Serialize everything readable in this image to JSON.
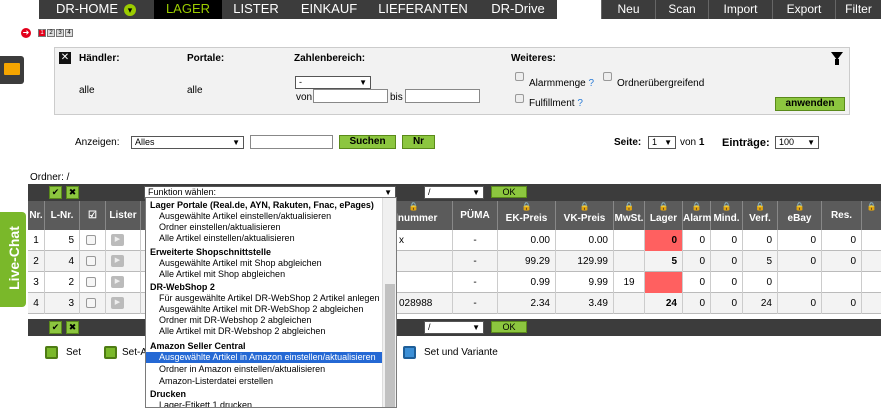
{
  "nav": {
    "items": [
      "DR-HOME",
      "LAGER",
      "LISTER",
      "EINKAUF",
      "LIEFERANTEN",
      "DR-Drive"
    ],
    "active": "LAGER",
    "right": [
      "Neu",
      "Scan",
      "Import",
      "Export",
      "Filter"
    ]
  },
  "pager": [
    "1",
    "2",
    "3",
    "4"
  ],
  "filter": {
    "haendler_label": "Händler:",
    "haendler_value": "alle",
    "portale_label": "Portale:",
    "portale_value": "alle",
    "zahlenbereich_label": "Zahlenbereich:",
    "zahlenbereich_select": "-",
    "von_label": "von",
    "bis_label": "bis",
    "weiteres_label": "Weiteres:",
    "alarmmenge_label": "Alarmmenge",
    "ordner_label": "Ordnerübergreifend",
    "fulfillment_label": "Fulfillment",
    "help": "?",
    "apply_label": "anwenden"
  },
  "search": {
    "anzeigen_label": "Anzeigen:",
    "anzeigen_value": "Alles",
    "search_label": "Suchen",
    "nr_label": "Nr",
    "seite_label": "Seite:",
    "seite_value": "1",
    "von_text": "von",
    "total_pages": "1",
    "eintraege_label": "Einträge:",
    "eintraege_value": "100"
  },
  "table": {
    "ordner_label": "Ordner: /",
    "funktion_select": "Funktion wählen:",
    "folder_select": "/",
    "ok_label": "OK",
    "lock_glyph": "🔒",
    "columns": [
      "Nr.",
      "L-Nr.",
      "☑",
      "Lister",
      "",
      "",
      "elnummer",
      "PÜMA",
      "EK-Preis",
      "VK-Preis",
      "MwSt.",
      "Lager",
      "Alarm",
      "Mind.",
      "Verf.",
      "eBay",
      "Res.",
      ""
    ],
    "rows": [
      {
        "nr": "1",
        "lnr": "5",
        "artnr": "x",
        "puema": "-",
        "ek": "0.00",
        "vk": "0.00",
        "mwst": "",
        "lager": "0",
        "alarm": "0",
        "mind": "0",
        "verf": "0",
        "ebay": "0",
        "res": "0"
      },
      {
        "nr": "2",
        "lnr": "4",
        "artnr": "",
        "puema": "-",
        "ek": "99.29",
        "vk": "129.99",
        "mwst": "",
        "lager": "5",
        "alarm": "0",
        "mind": "0",
        "verf": "5",
        "ebay": "0",
        "res": "0"
      },
      {
        "nr": "3",
        "lnr": "2",
        "artnr": "",
        "puema": "-",
        "ek": "0.99",
        "vk": "9.99",
        "mwst": "19",
        "lager": "",
        "alarm": "0",
        "mind": "0",
        "verf": "0",
        "ebay": "",
        "res": ""
      },
      {
        "nr": "4",
        "lnr": "3",
        "artnr": "028988",
        "puema": "-",
        "ek": "2.34",
        "vk": "3.49",
        "mwst": "",
        "lager": "24",
        "alarm": "0",
        "mind": "0",
        "verf": "24",
        "ebay": "0",
        "res": "0"
      }
    ]
  },
  "legend": {
    "set": "Set",
    "set_a": "Set-A",
    "set_variante": "Set und Variante"
  },
  "dropdown": {
    "groups": [
      {
        "label": "Lager Portale (Real.de, AYN, Rakuten, Fnac, ePages)",
        "items": [
          "Ausgewählte Artikel einstellen/aktualisieren",
          "Ordner einstellen/aktualisieren",
          "Alle Artikel einstellen/aktualisieren"
        ]
      },
      {
        "label": "Erweiterte Shopschnittstelle",
        "items": [
          "Ausgewählte Artikel mit Shop abgleichen",
          "Alle Artikel mit Shop abgleichen"
        ]
      },
      {
        "label": "DR-WebShop 2",
        "items": [
          "Für ausgewählte Artikel DR-WebShop 2 Artikel anlegen",
          "Ausgewählte Artikel mit DR-WebShop 2 abgleichen",
          "Ordner mit DR-Webshop 2 abgleichen",
          "Alle Artikel mit DR-Webshop 2 abgleichen"
        ]
      },
      {
        "label": "Amazon Seller Central",
        "items": [
          "Ausgewählte Artikel in Amazon einstellen/aktualisieren",
          "Ordner in Amazon einstellen/aktualisieren",
          "Amazon-Listerdatei erstellen"
        ]
      },
      {
        "label": "Drucken",
        "items": [
          "Lager-Etikett 1 drucken"
        ]
      }
    ],
    "highlighted": "Ausgewählte Artikel in Amazon einstellen/aktualisieren"
  },
  "livechat": "Live-Chat",
  "colors": {
    "nav_dark": "#3c3c3c",
    "accent_green": "#8cc63f",
    "alarm_red": "#ff6060",
    "highlight_blue": "#2468d4"
  }
}
